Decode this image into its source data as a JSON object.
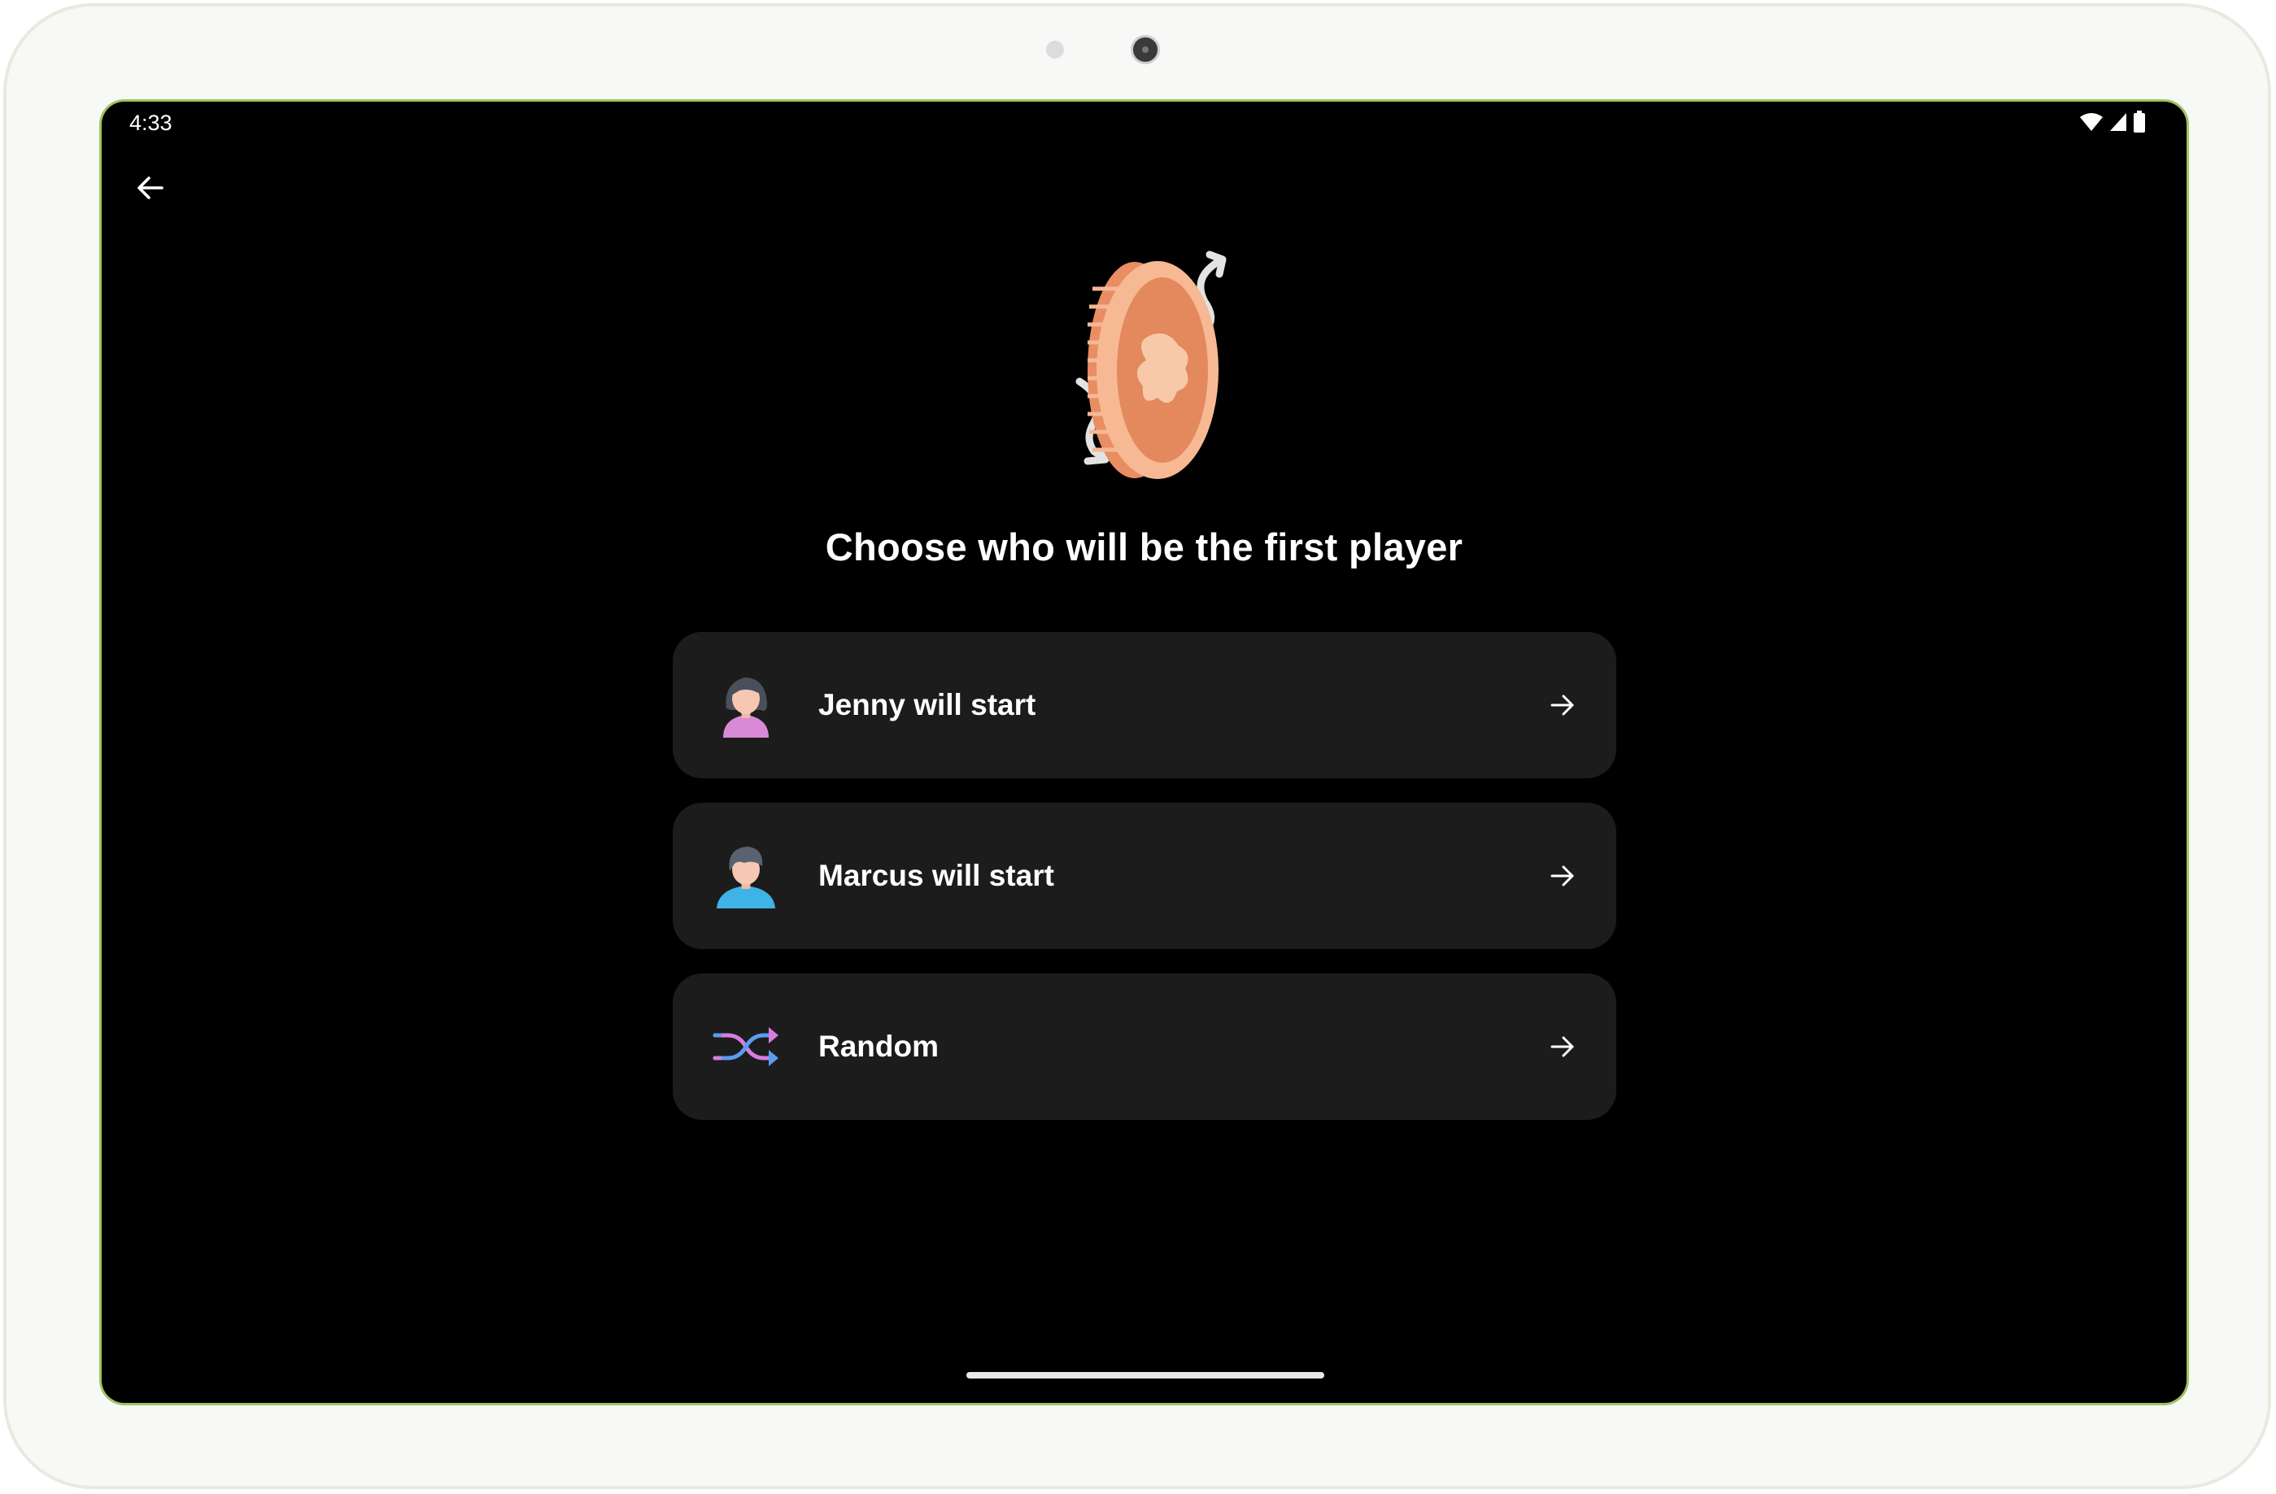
{
  "status_bar": {
    "time": "4:33",
    "icons": [
      "wifi-icon",
      "cellular-signal-icon",
      "battery-icon"
    ]
  },
  "navigation": {
    "back_icon": "arrow-back-icon"
  },
  "illustration": {
    "icon": "coin-flip-icon"
  },
  "title": "Choose who will be the first player",
  "options": [
    {
      "label": "Jenny will start",
      "icon": "female-avatar-icon",
      "trailing_icon": "arrow-forward-icon"
    },
    {
      "label": "Marcus will start",
      "icon": "male-avatar-icon",
      "trailing_icon": "arrow-forward-icon"
    },
    {
      "label": "Random",
      "icon": "shuffle-icon",
      "trailing_icon": "arrow-forward-icon"
    }
  ],
  "colors": {
    "screen_background": "#000000",
    "card_background": "#1c1c1c",
    "text": "#ffffff",
    "coin_orange": "#e8936a",
    "shuffle_pink": "#d77de0",
    "shuffle_blue": "#5a9cf0"
  }
}
